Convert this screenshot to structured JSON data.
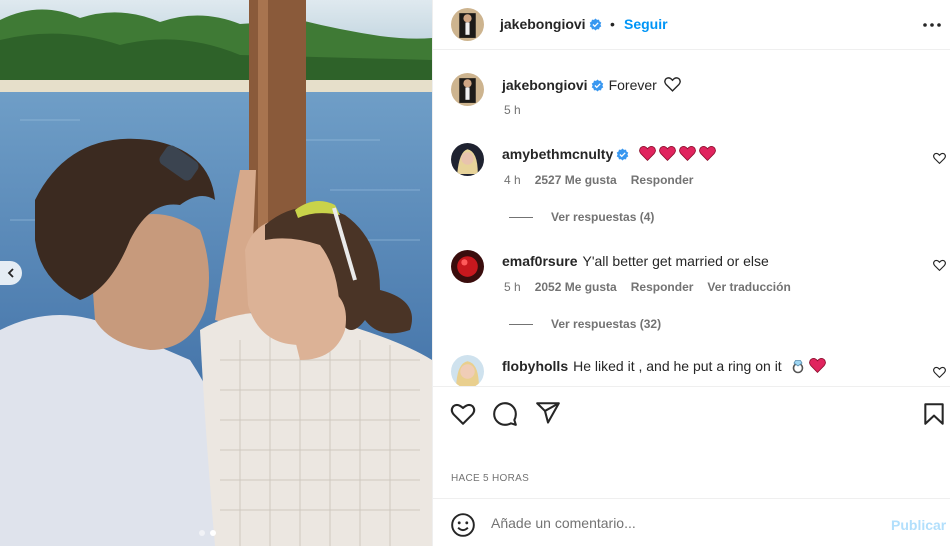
{
  "post": {
    "author": "jakebongiovi",
    "follow_label": "Seguir",
    "bullet": "•",
    "caption_text": "Forever",
    "caption_time": "5 h",
    "timestamp": "HACE 5 HORAS",
    "carousel": {
      "slides": 2,
      "active_index": 1
    }
  },
  "comments": [
    {
      "user": "amybethmcnulty",
      "verified": true,
      "text": "",
      "hearts": 4,
      "time": "4 h",
      "likes": "2527 Me gusta",
      "reply": "Responder",
      "translate": "",
      "replies_label": "Ver respuestas (4)"
    },
    {
      "user": "emaf0rsure",
      "verified": false,
      "text": "Y'all better get married or else",
      "hearts": 0,
      "time": "5 h",
      "likes": "2052 Me gusta",
      "reply": "Responder",
      "translate": "Ver traducción",
      "replies_label": "Ver respuestas (32)"
    },
    {
      "user": "flobyholls",
      "verified": false,
      "text": "He liked it , and he put a ring on it",
      "hearts": 1,
      "time": "",
      "likes": "",
      "reply": "",
      "translate": "",
      "replies_label": ""
    }
  ],
  "comment_box": {
    "placeholder": "Añade un comentario...",
    "publish_label": "Publicar"
  },
  "icons": {
    "more": "more-horizontal-icon",
    "like": "heart-outline-icon",
    "comment": "comment-bubble-icon",
    "share": "paper-plane-icon",
    "save": "bookmark-icon",
    "emoji": "smiley-icon",
    "verified": "verified-badge-icon",
    "ring": "ring-emoji-icon",
    "red_heart": "red-heart-emoji-icon"
  },
  "colors": {
    "link_blue": "#0095f6",
    "publish_disabled": "#b2dffc",
    "secondary_text": "#737373",
    "verified_blue": "#3897f0",
    "heart_red": "#e0245e"
  }
}
